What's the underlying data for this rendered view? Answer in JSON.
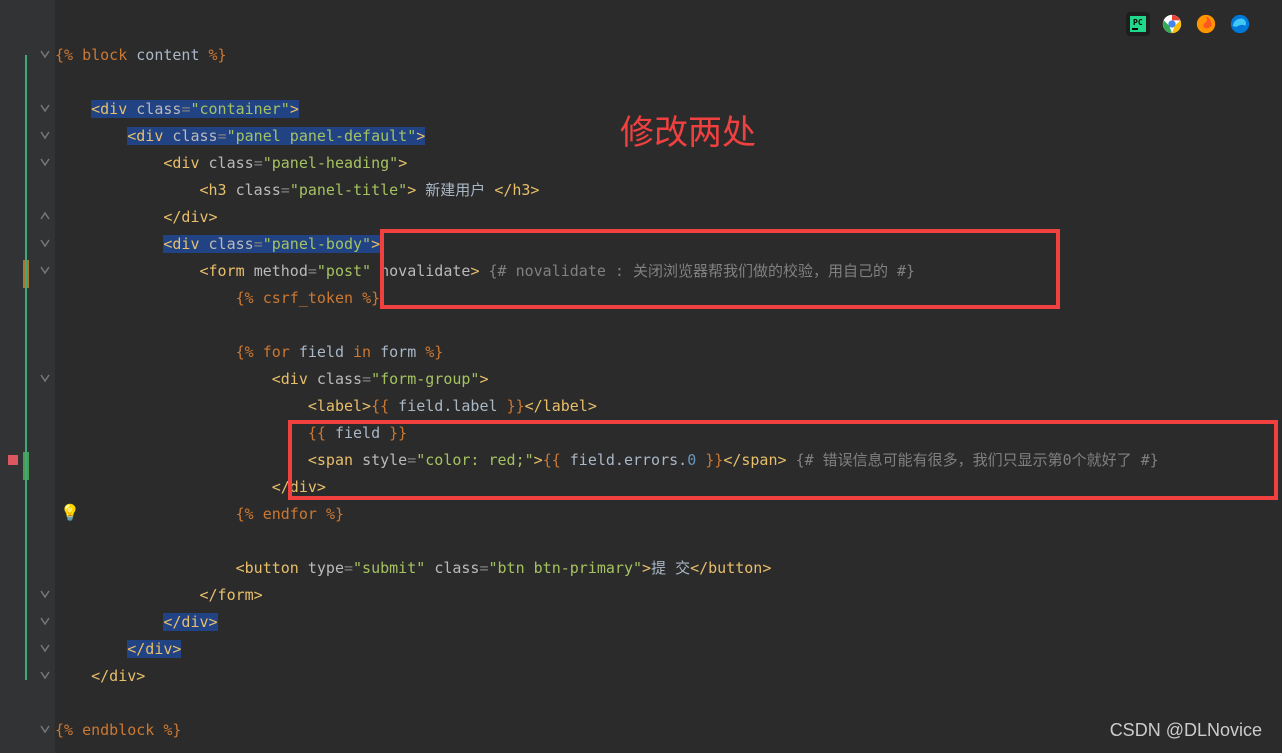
{
  "toolbar": {
    "icons": [
      "pycharm",
      "chrome",
      "firefox",
      "edge"
    ]
  },
  "annotation": {
    "title": "修改两处",
    "watermark": "CSDN @DLNovice"
  },
  "code": {
    "lines": [
      [
        [
          "template-tag",
          "{%"
        ],
        [
          "text",
          " "
        ],
        [
          "keyword",
          "block"
        ],
        [
          "text",
          " content "
        ],
        [
          "template-tag",
          "%}"
        ]
      ],
      [],
      [
        [
          "text",
          "    "
        ],
        [
          "tag",
          "<div"
        ],
        [
          "text",
          " "
        ],
        [
          "attr-name",
          "class"
        ],
        [
          "gray",
          "="
        ],
        [
          "attr-val",
          "\"container\""
        ],
        [
          "tag",
          ">"
        ]
      ],
      [
        [
          "text",
          "        "
        ],
        [
          "tag",
          "<div"
        ],
        [
          "text",
          " "
        ],
        [
          "attr-name",
          "class"
        ],
        [
          "gray",
          "="
        ],
        [
          "attr-val",
          "\"panel panel-default\""
        ],
        [
          "tag",
          ">"
        ]
      ],
      [
        [
          "text",
          "            "
        ],
        [
          "tag",
          "<div"
        ],
        [
          "text",
          " "
        ],
        [
          "attr-name",
          "class"
        ],
        [
          "gray",
          "="
        ],
        [
          "attr-val",
          "\"panel-heading\""
        ],
        [
          "tag",
          ">"
        ]
      ],
      [
        [
          "text",
          "                "
        ],
        [
          "tag",
          "<h3"
        ],
        [
          "text",
          " "
        ],
        [
          "attr-name",
          "class"
        ],
        [
          "gray",
          "="
        ],
        [
          "attr-val",
          "\"panel-title\""
        ],
        [
          "tag",
          ">"
        ],
        [
          "text",
          " 新建用户 "
        ],
        [
          "tag",
          "</h3>"
        ]
      ],
      [
        [
          "text",
          "            "
        ],
        [
          "tag",
          "</div>"
        ]
      ],
      [
        [
          "text",
          "            "
        ],
        [
          "tag",
          "<div"
        ],
        [
          "text",
          " "
        ],
        [
          "attr-name",
          "class"
        ],
        [
          "gray",
          "="
        ],
        [
          "attr-val",
          "\"panel-body\""
        ],
        [
          "tag",
          ">"
        ]
      ],
      [
        [
          "text",
          "                "
        ],
        [
          "tag",
          "<form"
        ],
        [
          "text",
          " "
        ],
        [
          "attr-name",
          "method"
        ],
        [
          "gray",
          "="
        ],
        [
          "attr-val",
          "\"post\""
        ],
        [
          "text",
          " "
        ],
        [
          "attr-name",
          "novalidate"
        ],
        [
          "tag",
          ">"
        ],
        [
          "text",
          " "
        ],
        [
          "comment",
          "{# novalidate : 关闭浏览器帮我们做的校验，用自己的 #}"
        ]
      ],
      [
        [
          "text",
          "                    "
        ],
        [
          "template-tag",
          "{%"
        ],
        [
          "text",
          " "
        ],
        [
          "keyword",
          "csrf_token"
        ],
        [
          "text",
          " "
        ],
        [
          "template-tag",
          "%}"
        ]
      ],
      [],
      [
        [
          "text",
          "                    "
        ],
        [
          "template-tag",
          "{%"
        ],
        [
          "text",
          " "
        ],
        [
          "keyword",
          "for"
        ],
        [
          "text",
          " field "
        ],
        [
          "keyword",
          "in"
        ],
        [
          "text",
          " form "
        ],
        [
          "template-tag",
          "%}"
        ]
      ],
      [
        [
          "text",
          "                        "
        ],
        [
          "tag",
          "<div"
        ],
        [
          "text",
          " "
        ],
        [
          "attr-name",
          "class"
        ],
        [
          "gray",
          "="
        ],
        [
          "attr-val",
          "\"form-group\""
        ],
        [
          "tag",
          ">"
        ]
      ],
      [
        [
          "text",
          "                            "
        ],
        [
          "tag",
          "<label>"
        ],
        [
          "template-var",
          "{{"
        ],
        [
          "text",
          " field.label "
        ],
        [
          "template-var",
          "}}"
        ],
        [
          "tag",
          "</label>"
        ]
      ],
      [
        [
          "text",
          "                            "
        ],
        [
          "template-var",
          "{{"
        ],
        [
          "text",
          " field "
        ],
        [
          "template-var",
          "}}"
        ]
      ],
      [
        [
          "text",
          "                            "
        ],
        [
          "tag",
          "<span"
        ],
        [
          "text",
          " "
        ],
        [
          "attr-name",
          "style"
        ],
        [
          "gray",
          "="
        ],
        [
          "attr-val",
          "\"color: red;\""
        ],
        [
          "tag",
          ">"
        ],
        [
          "template-var",
          "{{"
        ],
        [
          "text",
          " field.errors."
        ],
        [
          "num",
          "0"
        ],
        [
          "text",
          " "
        ],
        [
          "template-var",
          "}}"
        ],
        [
          "tag",
          "</span>"
        ],
        [
          "text",
          " "
        ],
        [
          "comment",
          "{# 错误信息可能有很多，我们只显示第0个就好了 #}"
        ]
      ],
      [
        [
          "text",
          "                        "
        ],
        [
          "tag",
          "</div>"
        ]
      ],
      [
        [
          "text",
          "                    "
        ],
        [
          "template-tag",
          "{%"
        ],
        [
          "text",
          " "
        ],
        [
          "keyword",
          "endfor"
        ],
        [
          "text",
          " "
        ],
        [
          "template-tag",
          "%}"
        ]
      ],
      [],
      [
        [
          "text",
          "                    "
        ],
        [
          "tag",
          "<button"
        ],
        [
          "text",
          " "
        ],
        [
          "attr-name",
          "type"
        ],
        [
          "gray",
          "="
        ],
        [
          "attr-val",
          "\"submit\""
        ],
        [
          "text",
          " "
        ],
        [
          "attr-name",
          "class"
        ],
        [
          "gray",
          "="
        ],
        [
          "attr-val",
          "\"btn btn-primary\""
        ],
        [
          "tag",
          ">"
        ],
        [
          "text",
          "提 交"
        ],
        [
          "tag",
          "</button>"
        ]
      ],
      [
        [
          "text",
          "                "
        ],
        [
          "tag",
          "</form>"
        ]
      ],
      [
        [
          "text",
          "            "
        ],
        [
          "tag",
          "</div>"
        ]
      ],
      [
        [
          "text",
          "        "
        ],
        [
          "tag",
          "</div>"
        ]
      ],
      [
        [
          "text",
          "    "
        ],
        [
          "tag",
          "</div>"
        ]
      ],
      [],
      [
        [
          "template-tag",
          "{%"
        ],
        [
          "text",
          " "
        ],
        [
          "keyword",
          "endblock"
        ],
        [
          "text",
          " "
        ],
        [
          "template-tag",
          "%}"
        ]
      ]
    ]
  },
  "selected_lines": [
    2,
    3,
    7,
    21,
    22
  ],
  "fold_marks_at": [
    0,
    2,
    3,
    4,
    7,
    8,
    12,
    20,
    21,
    22,
    23,
    25
  ],
  "close_fold_at": [
    6
  ],
  "breakpoint_line": 15,
  "bulb_line": 17
}
